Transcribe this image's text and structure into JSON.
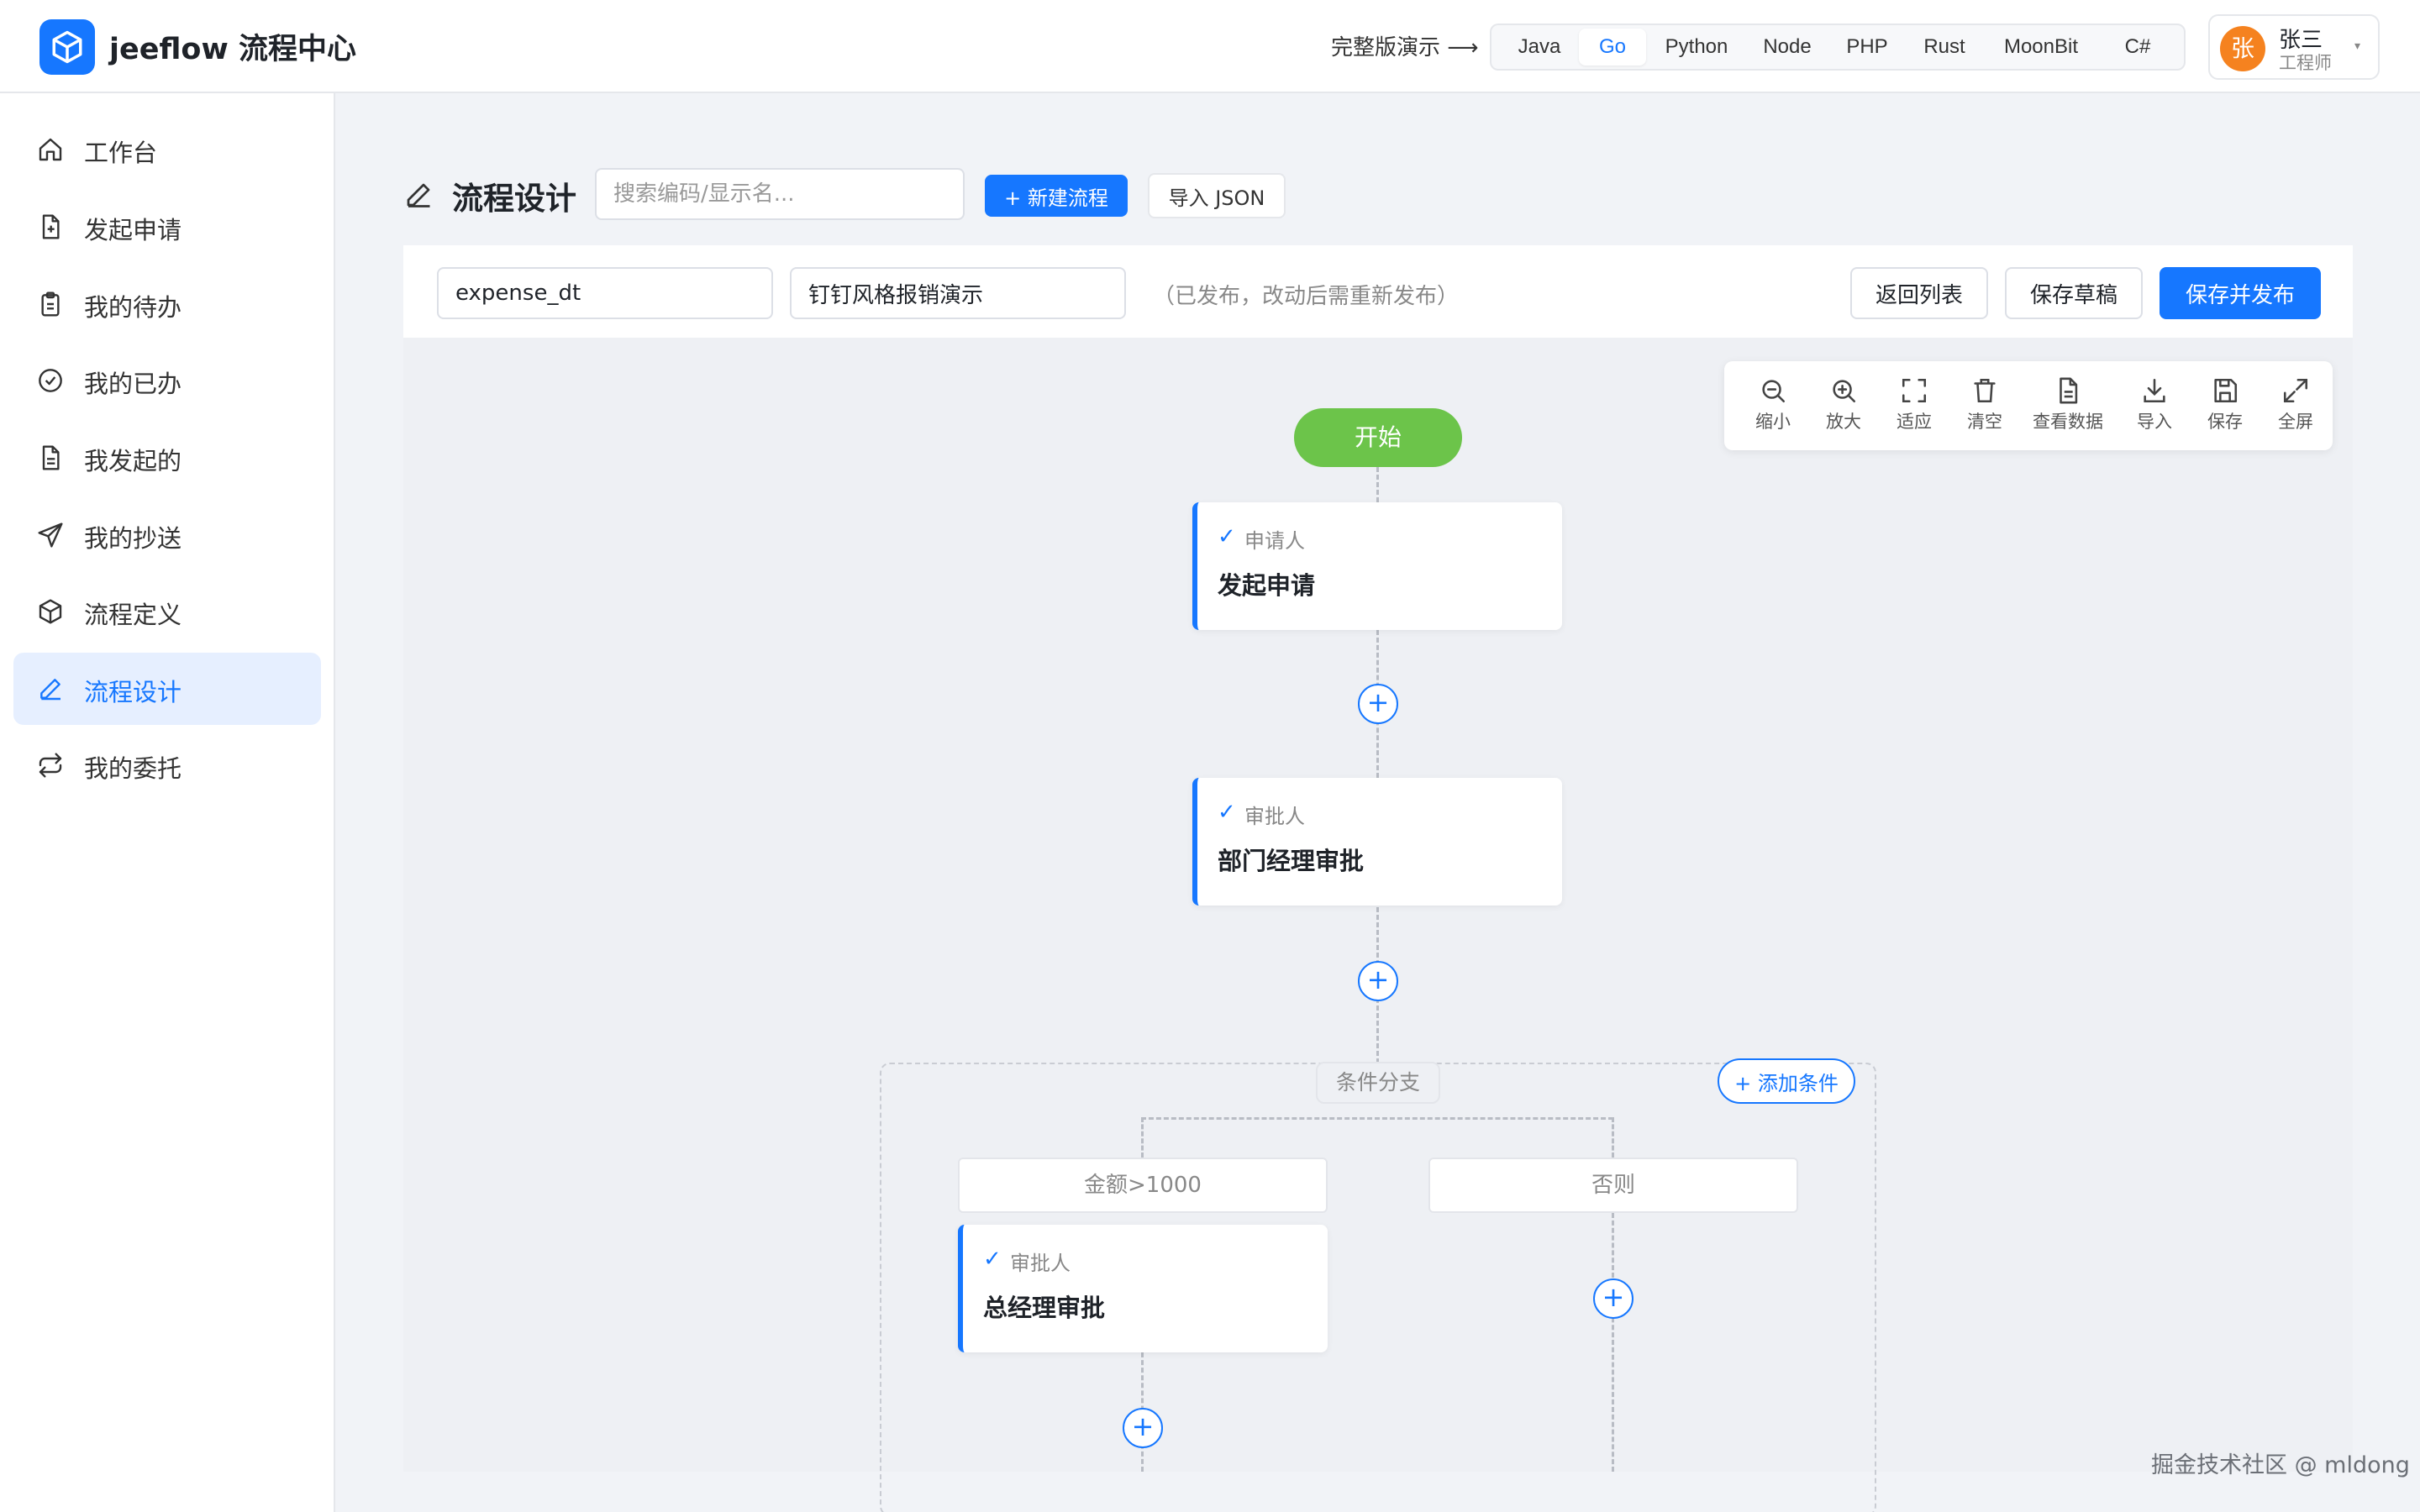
{
  "header": {
    "brand": "jeeflow 流程中心",
    "demo_link": "完整版演示 ⟶",
    "languages": [
      {
        "label": "Java",
        "active": false
      },
      {
        "label": "Go",
        "active": true
      },
      {
        "label": "Python",
        "active": false
      },
      {
        "label": "Node",
        "active": false
      },
      {
        "label": "PHP",
        "active": false
      },
      {
        "label": "Rust",
        "active": false
      },
      {
        "label": "MoonBit",
        "active": false
      },
      {
        "label": "C#",
        "active": false
      }
    ],
    "user": {
      "avatar_text": "张",
      "name": "张三",
      "role": "工程师",
      "caret": "▾",
      "avatar_color": "#f5821f"
    }
  },
  "sidebar": {
    "items": [
      {
        "label": "工作台",
        "icon": "home-icon",
        "active": false
      },
      {
        "label": "发起申请",
        "icon": "file-plus-icon",
        "active": false
      },
      {
        "label": "我的待办",
        "icon": "clipboard-icon",
        "active": false
      },
      {
        "label": "我的已办",
        "icon": "check-circle-icon",
        "active": false
      },
      {
        "label": "我发起的",
        "icon": "file-text-icon",
        "active": false
      },
      {
        "label": "我的抄送",
        "icon": "send-icon",
        "active": false
      },
      {
        "label": "流程定义",
        "icon": "box-icon",
        "active": false
      },
      {
        "label": "流程设计",
        "icon": "pencil-icon",
        "active": true
      },
      {
        "label": "我的委托",
        "icon": "repeat-icon",
        "active": false
      }
    ]
  },
  "page": {
    "title": "流程设计",
    "search_placeholder": "搜索编码/显示名...",
    "new_button": "+ 新建流程",
    "import_button": "导入 JSON"
  },
  "editor": {
    "code_value": "expense_dt",
    "name_value": "钉钉风格报销演示",
    "status_note": "（已发布，改动后需重新发布）",
    "back_button": "返回列表",
    "save_draft_button": "保存草稿",
    "save_publish_button": "保存并发布"
  },
  "canvas_tools": [
    {
      "label": "缩小",
      "icon": "zoom-out-icon"
    },
    {
      "label": "放大",
      "icon": "zoom-in-icon"
    },
    {
      "label": "适应",
      "icon": "fit-icon"
    },
    {
      "label": "清空",
      "icon": "trash-icon"
    },
    {
      "label": "查看数据",
      "icon": "document-icon"
    },
    {
      "label": "导入",
      "icon": "download-icon"
    },
    {
      "label": "保存",
      "icon": "save-icon"
    },
    {
      "label": "全屏",
      "icon": "fullscreen-icon"
    }
  ],
  "flow": {
    "start": "开始",
    "nodes": [
      {
        "check": "✓",
        "role": "申请人",
        "title": "发起申请"
      },
      {
        "check": "✓",
        "role": "审批人",
        "title": "部门经理审批"
      },
      {
        "check": "✓",
        "role": "审批人",
        "title": "总经理审批"
      }
    ],
    "plus": "+",
    "branch_title": "条件分支",
    "add_condition": "+ 添加条件",
    "conditions": [
      "金额>1000",
      "否则"
    ]
  },
  "watermark": "掘金技术社区 @ mldong",
  "colors": {
    "primary": "#1677ff",
    "start": "#6cc44a",
    "avatar": "#f5821f"
  }
}
